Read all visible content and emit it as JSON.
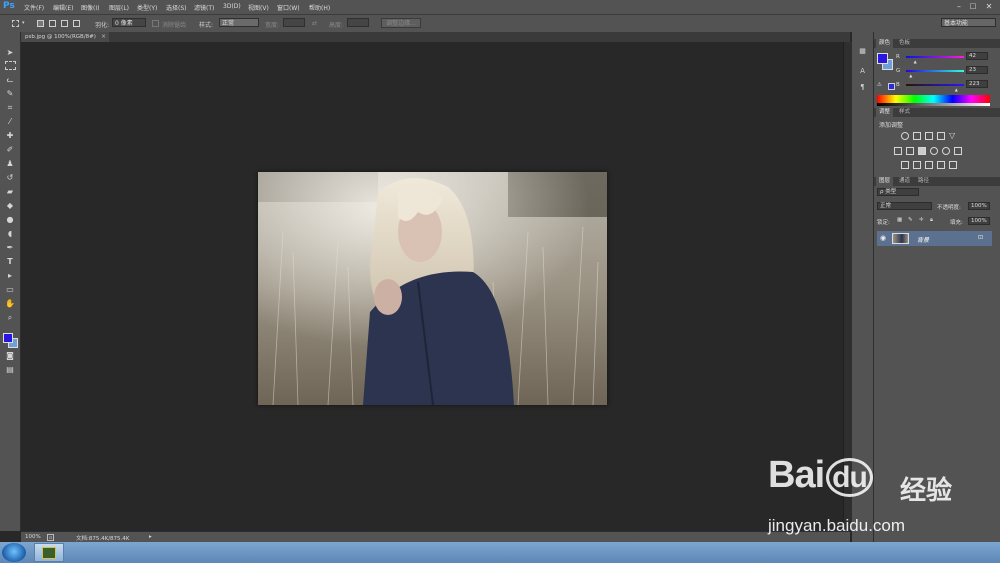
{
  "app": {
    "logo": "Ps"
  },
  "menu": [
    "文件(F)",
    "编辑(E)",
    "图像(I)",
    "图层(L)",
    "类型(Y)",
    "选择(S)",
    "滤镜(T)",
    "3D(D)",
    "视图(V)",
    "窗口(W)",
    "帮助(H)"
  ],
  "window_controls": {
    "minimize": "–",
    "maximize": "□",
    "close": "✕"
  },
  "options_bar": {
    "feather_label": "羽化:",
    "feather_value": "0 像素",
    "antialias_label": "消除锯齿",
    "style_label": "样式:",
    "style_value": "正常",
    "width_label": "宽度:",
    "height_label": "高度:",
    "refine_edge_button": "调整边缘...",
    "workspace_select": "基本功能"
  },
  "document": {
    "tab_title": "psb.jpg @ 100%(RGB/8#)",
    "close_glyph": "×"
  },
  "status": {
    "zoom": "100%",
    "doc_size": "文档:875.4K/875.4K"
  },
  "color_panel": {
    "tabs": [
      "颜色",
      "色板"
    ],
    "channels": [
      {
        "label": "R",
        "value": "42",
        "fraction": 0.165
      },
      {
        "label": "G",
        "value": "23",
        "fraction": 0.09
      },
      {
        "label": "B",
        "value": "223",
        "fraction": 0.874
      }
    ],
    "foreground_color": "#2a17df",
    "background_color": "#6f9fd8"
  },
  "adjustments_panel": {
    "tabs": [
      "调整",
      "样式"
    ],
    "title": "添加调整"
  },
  "layers_panel": {
    "tabs": [
      "图层",
      "通道",
      "路径"
    ],
    "kind_filter": "ρ 类型",
    "blend_mode": "正常",
    "opacity_label": "不透明度:",
    "opacity_value": "100%",
    "lock_label": "锁定:",
    "fill_label": "填充:",
    "fill_value": "100%",
    "layers": [
      {
        "name": "背景",
        "visible": true,
        "locked": true
      }
    ]
  },
  "taskbar": {
    "start": "start-orb",
    "apps": [
      "photoshop"
    ]
  },
  "watermark": {
    "logo": "Bai",
    "logo2": "du",
    "cn": "经验",
    "url": "jingyan.baidu.com"
  }
}
